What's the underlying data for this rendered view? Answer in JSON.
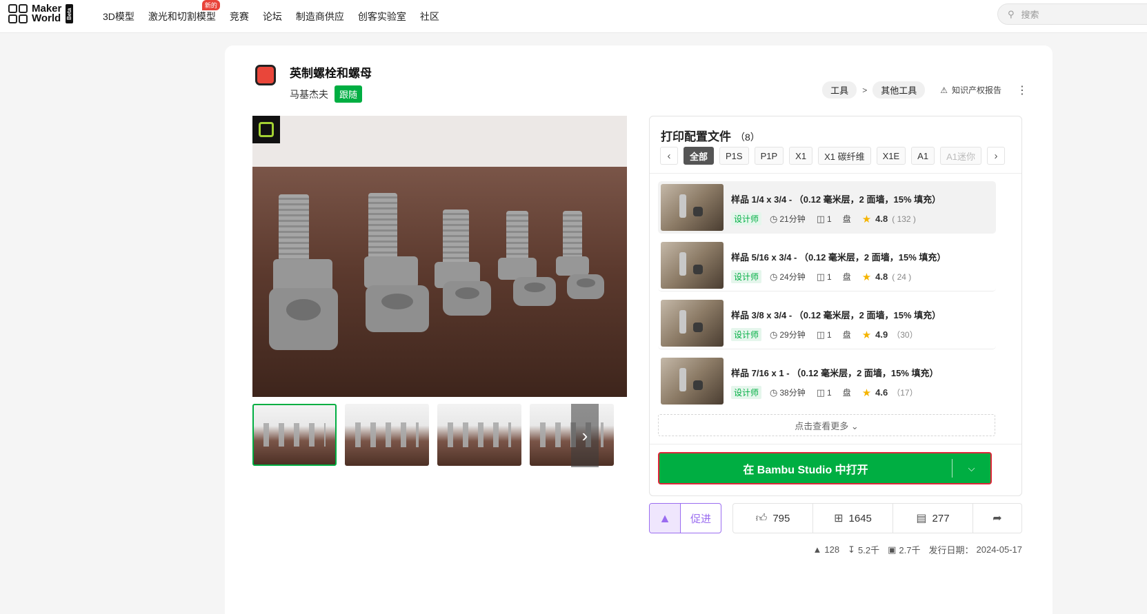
{
  "nav": {
    "logo_line1": "Maker",
    "logo_line2": "World",
    "logo_badge": "Beta",
    "links": [
      "3D模型",
      "激光和切割模型",
      "竞赛",
      "论坛",
      "制造商供应",
      "创客实验室",
      "社区"
    ],
    "new_badge": "新的",
    "search_placeholder": "搜索"
  },
  "model": {
    "title": "英制螺栓和螺母",
    "author": "马基杰夫",
    "follow_label": "跟随",
    "breadcrumb": [
      "工具",
      "其他工具"
    ],
    "breadcrumb_sep": ">",
    "ip_report": "知识产权报告"
  },
  "profiles": {
    "title": "打印配置文件",
    "count": "（8）",
    "filters": [
      "全部",
      "P1S",
      "P1P",
      "X1",
      "X1 碳纤维",
      "X1E",
      "A1",
      "A1迷你"
    ],
    "items": [
      {
        "title": "样品 1/4 x 3/4 - （0.12 毫米层，2 面墙，15% 填充）",
        "badge": "设计师",
        "time": "21分钟",
        "plates": "1",
        "rating": "4.8",
        "count": "( 132 )"
      },
      {
        "title": "样品 5/16 x 3/4 - （0.12 毫米层，2 面墙，15% 填充）",
        "badge": "设计师",
        "time": "24分钟",
        "plates": "1",
        "rating": "4.8",
        "count": "( 24 )"
      },
      {
        "title": "样品 3/8 x 3/4 - （0.12 毫米层，2 面墙，15% 填充）",
        "badge": "设计师",
        "time": "29分钟",
        "plates": "1",
        "rating": "4.9",
        "count": "（30）"
      },
      {
        "title": "样品 7/16 x 1 - （0.12 毫米层，2 面墙，15% 填充）",
        "badge": "设计师",
        "time": "38分钟",
        "plates": "1",
        "rating": "4.6",
        "count": "（17）"
      }
    ],
    "plate_unit": "盘",
    "see_more": "点击查看更多",
    "open_label": "在 Bambu Studio 中打开"
  },
  "actions": {
    "boost_label": "促进",
    "likes": "795",
    "collects": "1645",
    "comments": "277"
  },
  "footer": {
    "boosts": "128",
    "downloads": "5.2千",
    "prints": "2.7千",
    "release_label": "发行日期：",
    "release_date": "2024-05-17"
  },
  "colors": {
    "brand_green": "#00ae42",
    "highlight_red": "#e0263a",
    "boost_purple": "#9a6cf0",
    "star_yellow": "#f5b400"
  },
  "icons": [
    "search-icon",
    "clock-icon",
    "plate-icon",
    "star-icon",
    "thumbs-up-icon",
    "collect-icon",
    "comment-icon",
    "share-icon",
    "rocket-icon",
    "download-icon",
    "print-icon"
  ]
}
